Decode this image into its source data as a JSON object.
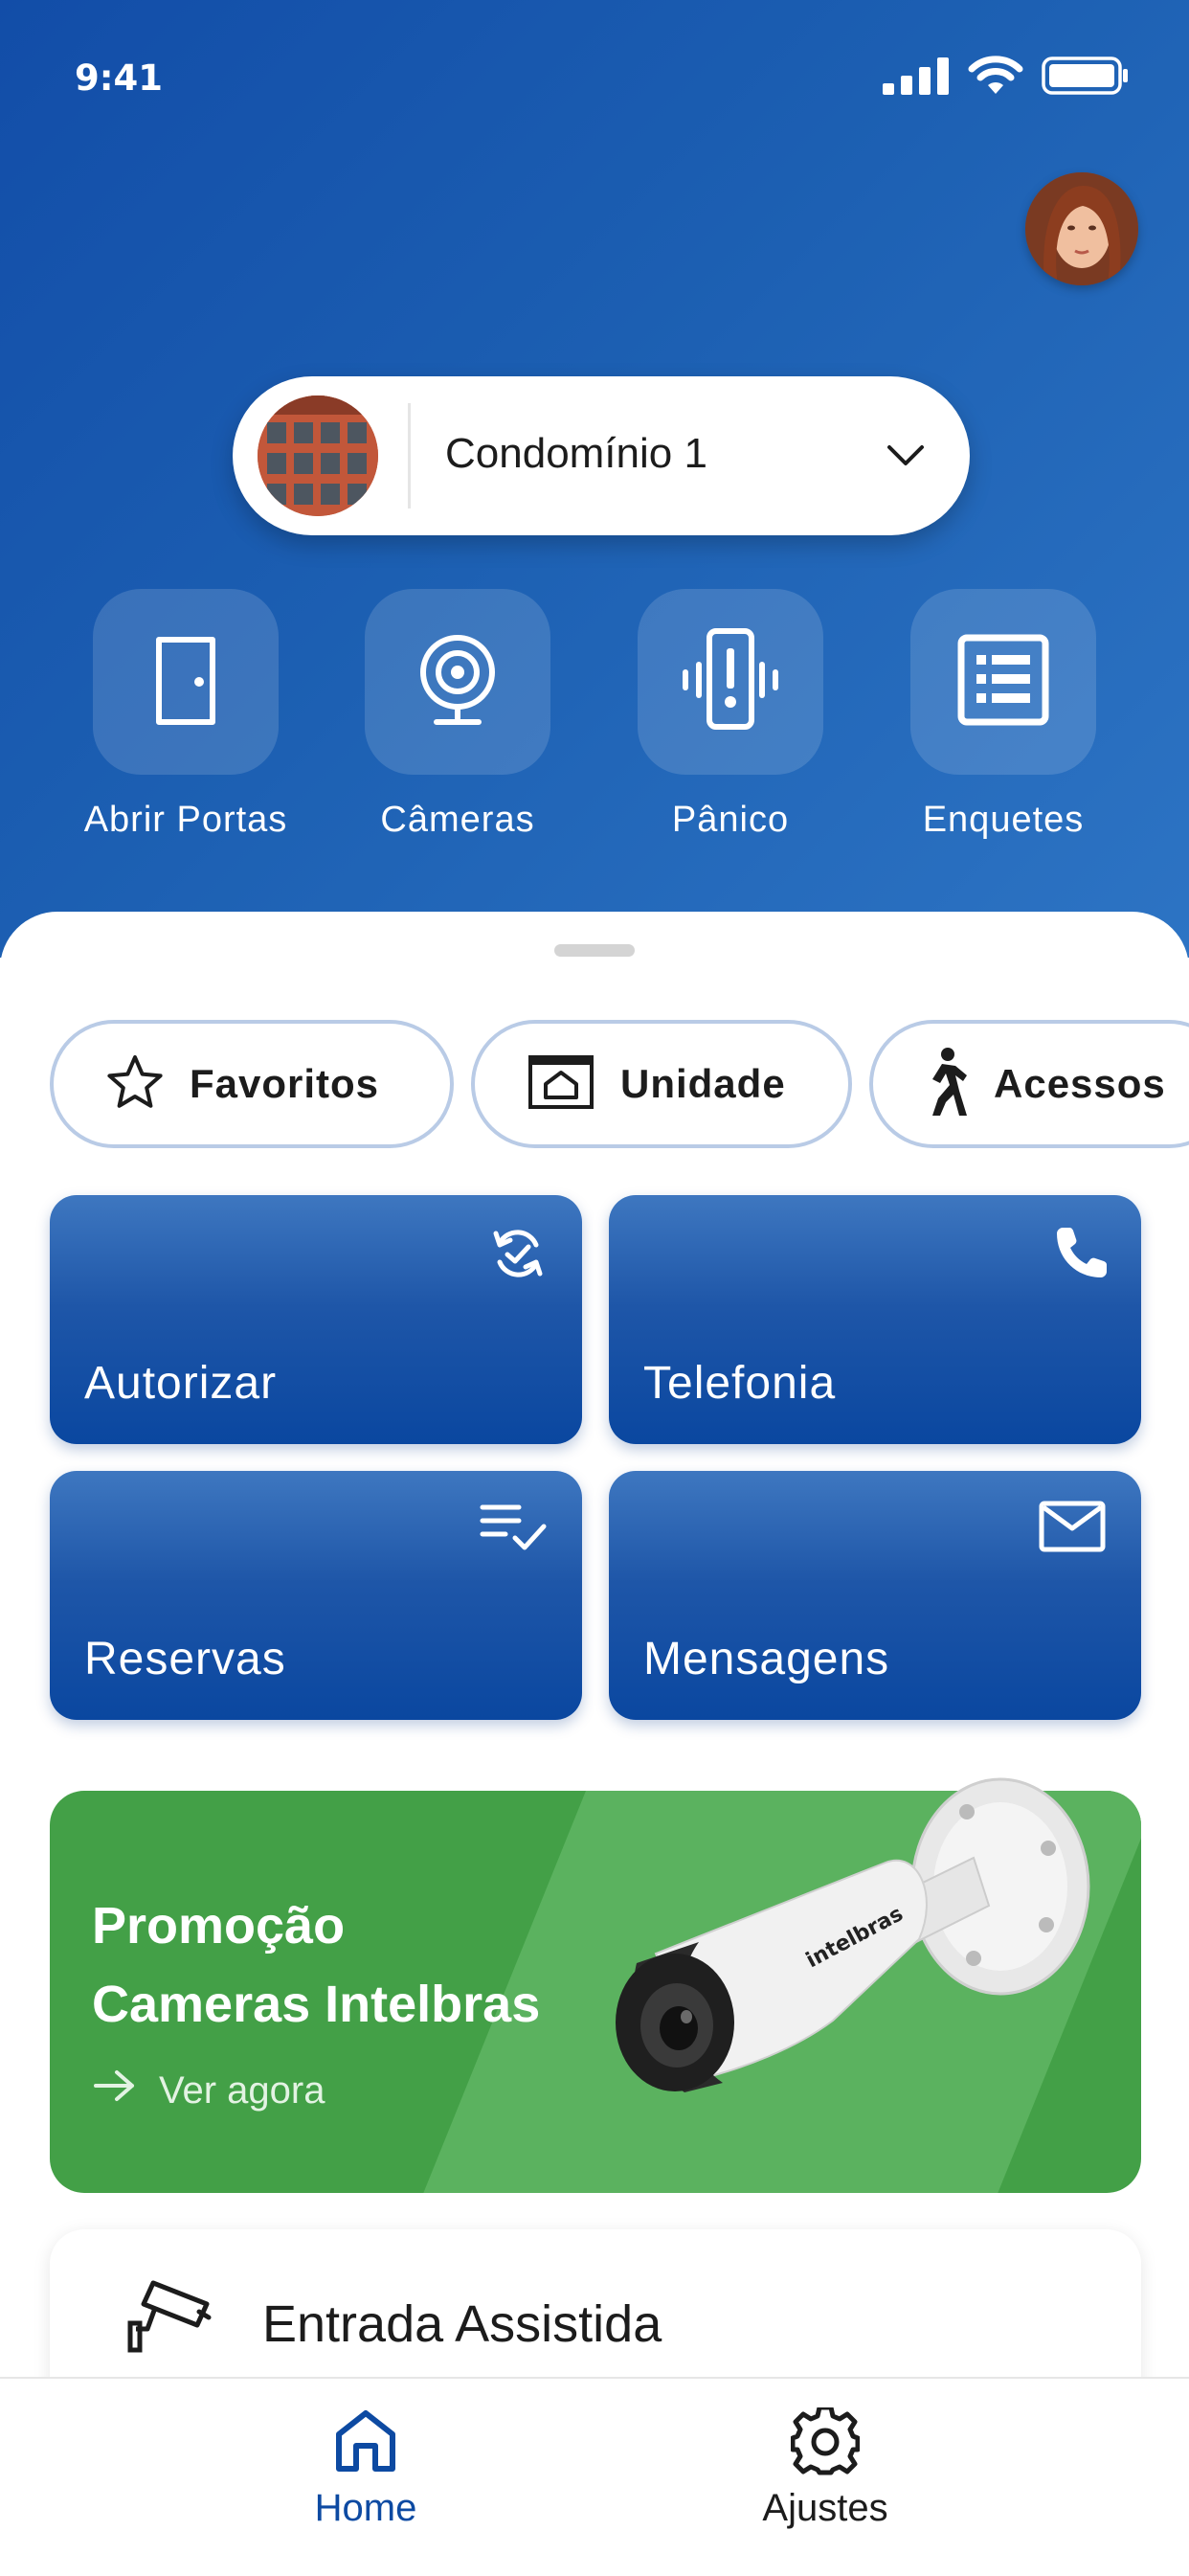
{
  "status_bar": {
    "time": "9:41"
  },
  "header": {
    "avatar_alt": "Foto de perfil",
    "condo_selector": {
      "label": "Condomínio 1"
    }
  },
  "quick_actions": [
    {
      "label": "Abrir Portas",
      "icon": "door-icon"
    },
    {
      "label": "Câmeras",
      "icon": "webcam-icon"
    },
    {
      "label": "Pânico",
      "icon": "panic-vibrate-icon"
    },
    {
      "label": "Enquetes",
      "icon": "list-icon"
    }
  ],
  "chips": [
    {
      "label": "Favoritos",
      "icon": "star-icon"
    },
    {
      "label": "Unidade",
      "icon": "unit-home-icon"
    },
    {
      "label": "Acessos",
      "icon": "walking-person-icon"
    }
  ],
  "cards": [
    {
      "label": "Autorizar",
      "icon": "sync-check-icon"
    },
    {
      "label": "Telefonia",
      "icon": "phone-icon"
    },
    {
      "label": "Reservas",
      "icon": "checklist-icon"
    },
    {
      "label": "Mensagens",
      "icon": "mail-icon"
    }
  ],
  "promo": {
    "title_line1": "Promoção",
    "title_line2": "Cameras Intelbras",
    "cta": "Ver agora",
    "camera_brand": "intelbras",
    "color": "#43a047"
  },
  "assisted_entry": {
    "label": "Entrada Assistida",
    "icon": "security-camera-icon"
  },
  "tabbar": {
    "items": [
      {
        "label": "Home",
        "icon": "home-icon",
        "active": true
      },
      {
        "label": "Ajustes",
        "icon": "gear-icon",
        "active": false
      }
    ]
  },
  "colors": {
    "primary": "#0d4aa2",
    "accent_light": "#2d74c4",
    "promo": "#43a047"
  }
}
